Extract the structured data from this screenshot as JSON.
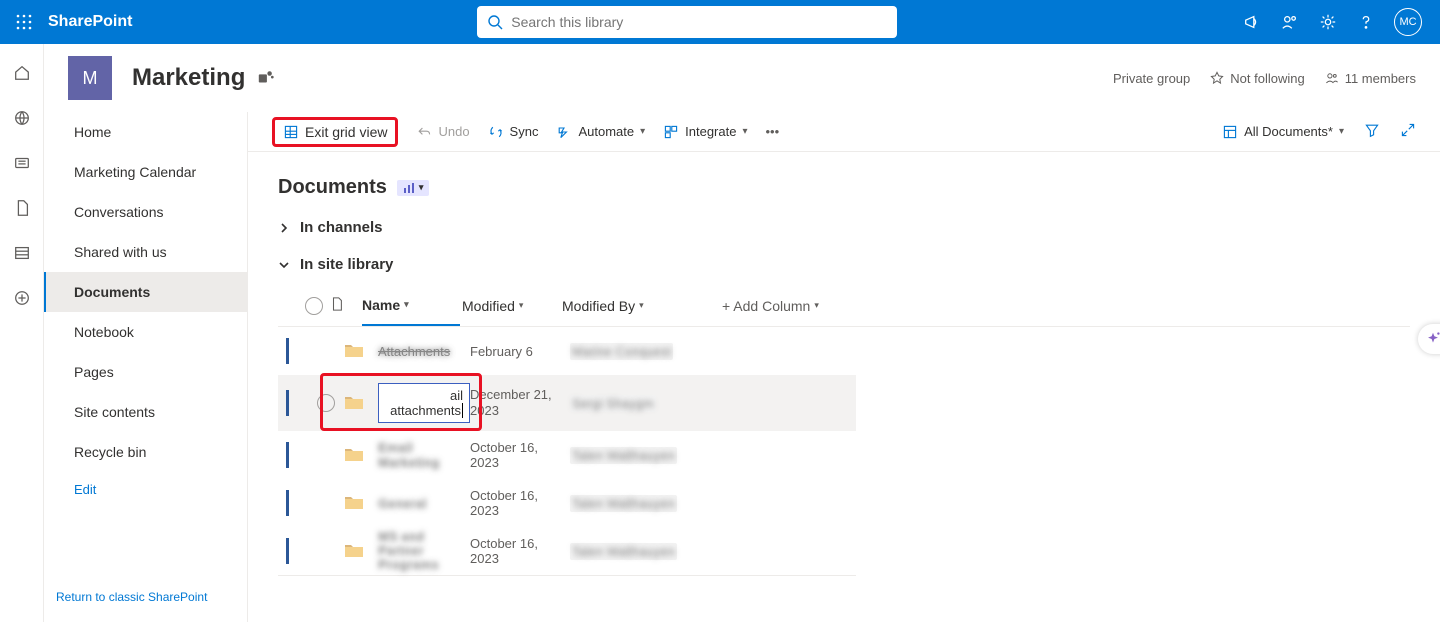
{
  "header": {
    "brand": "SharePoint",
    "search_placeholder": "Search this library",
    "avatar_initials": "MC"
  },
  "site": {
    "logo_letter": "M",
    "title": "Marketing",
    "privacy": "Private group",
    "follow_label": "Not following",
    "members_label": "11 members"
  },
  "nav": {
    "items": [
      "Home",
      "Marketing Calendar",
      "Conversations",
      "Shared with us",
      "Documents",
      "Notebook",
      "Pages",
      "Site contents",
      "Recycle bin"
    ],
    "active_index": 4,
    "edit_label": "Edit",
    "classic_label": "Return to classic SharePoint"
  },
  "cmd": {
    "exit_grid": "Exit grid view",
    "undo": "Undo",
    "sync": "Sync",
    "automate": "Automate",
    "integrate": "Integrate"
  },
  "view": {
    "current": "All Documents*"
  },
  "library": {
    "title": "Documents",
    "groups": {
      "channels": "In channels",
      "site": "In site library"
    },
    "columns": {
      "name": "Name",
      "modified": "Modified",
      "modified_by": "Modified By",
      "add": "+ Add Column"
    },
    "rows": [
      {
        "name": "Attachments",
        "name_strike": true,
        "modified": "February 6",
        "by": "Marine Conquest"
      },
      {
        "name_edit": "ail attachments",
        "modified": "December 21, 2023",
        "by": "Sergi Shaygm",
        "selected": true
      },
      {
        "name": "Email Marketing",
        "modified": "October 16, 2023",
        "by": "Talen Walthauyen"
      },
      {
        "name": "General",
        "modified": "October 16, 2023",
        "by": "Talen Walthauyen"
      },
      {
        "name": "MS and Partner Programs",
        "modified": "October 16, 2023",
        "by": "Talen Walthauyen"
      }
    ]
  }
}
